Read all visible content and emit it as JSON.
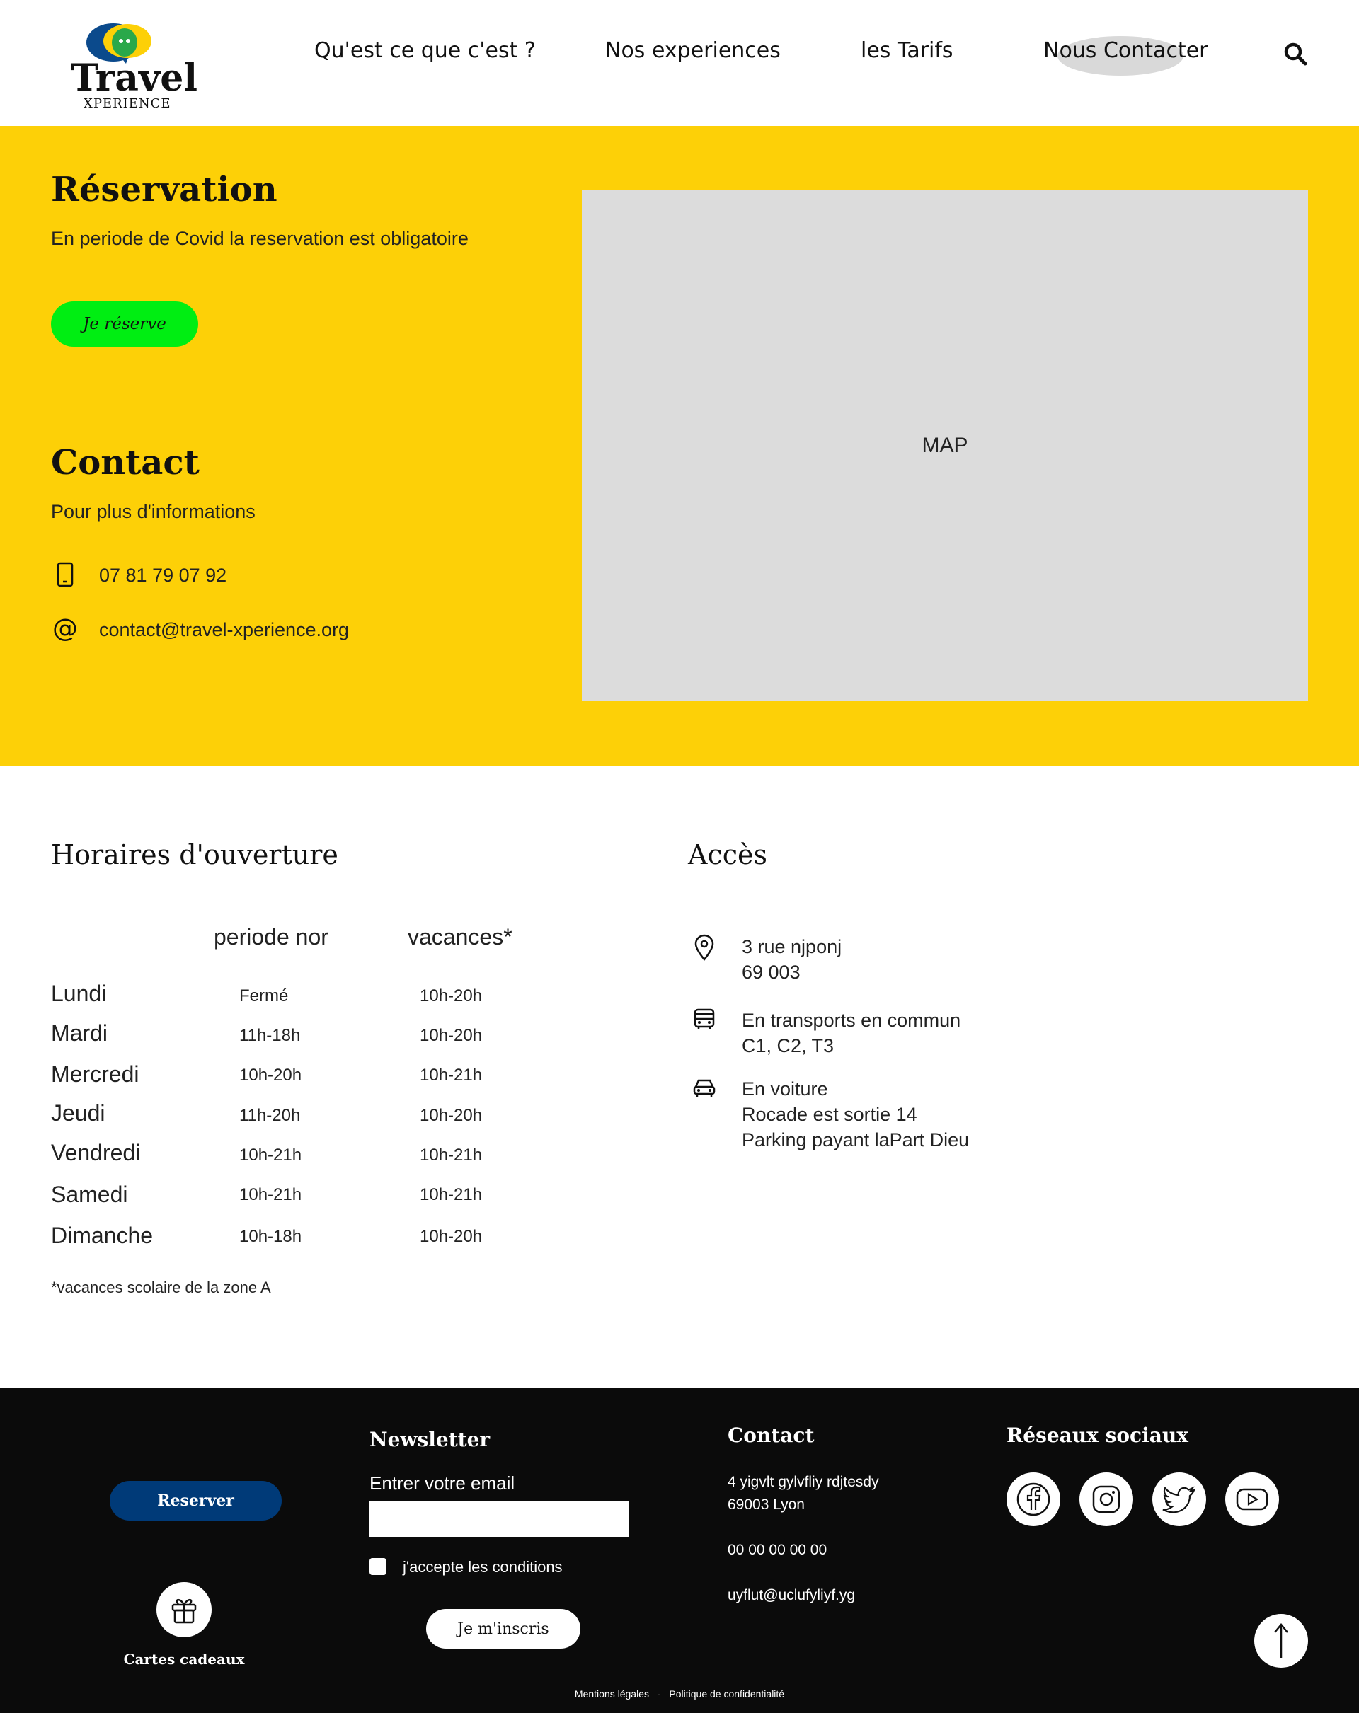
{
  "brand": {
    "name_main": "Travel",
    "name_sub": "XPERIENCE",
    "colors": {
      "blue": "#0b4a8c",
      "yellow": "#fdd007",
      "green": "#00ee12",
      "footer_bg": "#0b0b0b",
      "reserve_blue": "#003a78"
    }
  },
  "nav": {
    "items": [
      "Qu'est ce que c'est ?",
      "Nos experiences",
      "les Tarifs",
      "Nous Contacter"
    ],
    "search_icon": "search-icon"
  },
  "reservation": {
    "title": "Réservation",
    "text": "En periode de Covid la reservation est obligatoire",
    "button": "Je réserve"
  },
  "contact": {
    "title": "Contact",
    "subtitle": "Pour plus d'informations",
    "phone": "07 81 79 07 92",
    "email": "contact@travel-xperience.org"
  },
  "map": {
    "label": "MAP"
  },
  "hours": {
    "title": "Horaires d'ouverture",
    "col1": "periode nor",
    "col2": "vacances*",
    "rows": [
      {
        "day": "Lundi",
        "normal": "Fermé",
        "holiday": "10h-20h"
      },
      {
        "day": "Mardi",
        "normal": "11h-18h",
        "holiday": "10h-20h"
      },
      {
        "day": "Mercredi",
        "normal": "10h-20h",
        "holiday": "10h-21h"
      },
      {
        "day": "Jeudi",
        "normal": "11h-20h",
        "holiday": "10h-20h"
      },
      {
        "day": "Vendredi",
        "normal": "10h-21h",
        "holiday": "10h-21h"
      },
      {
        "day": "Samedi",
        "normal": "10h-21h",
        "holiday": "10h-21h"
      },
      {
        "day": "Dimanche",
        "normal": "10h-18h",
        "holiday": "10h-20h"
      }
    ],
    "note": "*vacances scolaire de la zone A"
  },
  "access": {
    "title": "Accès",
    "address_line1": "3 rue njponj",
    "address_line2": "69 003",
    "transport_line1": "En transports en commun",
    "transport_line2": "C1, C2, T3",
    "car_line1": "En voiture",
    "car_line2": "Rocade est sortie 14",
    "car_line3": "Parking payant laPart Dieu"
  },
  "footer": {
    "reserve_button": "Reserver",
    "gift_label": "Cartes cadeaux",
    "newsletter": {
      "title": "Newsletter",
      "label": "Entrer votre email",
      "email_value": "",
      "checkbox_label": "j'accepte les conditions",
      "button": "Je m'inscris"
    },
    "contact": {
      "title": "Contact",
      "address_line1": "4 yigvlt gylvfliy rdjtesdy",
      "address_line2": "69003 Lyon",
      "phone": "00 00 00 00 00",
      "email": "uyflut@uclufyliyf.yg"
    },
    "social": {
      "title": "Réseaux sociaux",
      "icons": [
        "facebook-icon",
        "instagram-icon",
        "twitter-icon",
        "youtube-icon"
      ]
    },
    "legal": "Mentions légales",
    "separator": "-",
    "privacy": "Politique de confidentialité"
  }
}
